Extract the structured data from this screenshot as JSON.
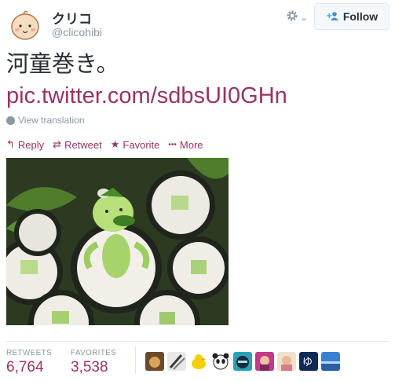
{
  "user": {
    "display_name": "クリコ",
    "handle": "@clicohibi",
    "avatar_icon": "baby-face-icon"
  },
  "header": {
    "settings_icon": "gear-icon",
    "dropdown_glyph": "⌄",
    "follow_label": "Follow",
    "follow_icon": "person-plus-icon"
  },
  "tweet": {
    "text": "河童巻き。",
    "link": "pic.twitter.com/sdbsUI0GHn",
    "view_translation": "View translation"
  },
  "actions": [
    {
      "label": "Reply",
      "icon": "reply-icon",
      "glyph": "↰"
    },
    {
      "label": "Retweet",
      "icon": "retweet-icon",
      "glyph": "⇄"
    },
    {
      "label": "Favorite",
      "icon": "star-icon",
      "glyph": "★"
    },
    {
      "label": "More",
      "icon": "more-dots-icon",
      "glyph": "•••"
    }
  ],
  "stats": {
    "retweets_label": "RETWEETS",
    "retweets_value": "6,764",
    "favorites_label": "FAVORITES",
    "favorites_value": "3,538"
  },
  "colors": {
    "link": "#993366",
    "muted": "#8899a6",
    "text": "#292f33",
    "follow_icon": "#3b94d9"
  }
}
